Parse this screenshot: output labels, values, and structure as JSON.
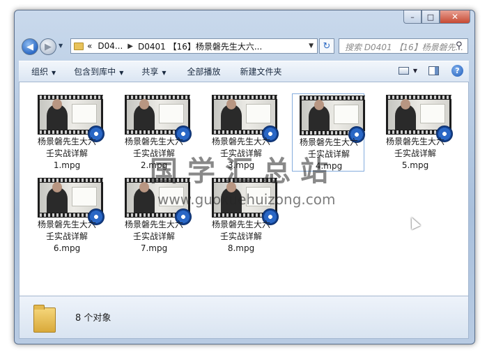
{
  "window": {
    "controls": {
      "minimize": "–",
      "maximize": "□",
      "close": "✕"
    }
  },
  "navigation": {
    "back_icon": "back-arrow-icon",
    "forward_icon": "forward-arrow-icon",
    "breadcrumb": {
      "overflow": "«",
      "parent": "D04...",
      "current": "D0401 【16】杨景磐先生大六..."
    },
    "search_placeholder": "搜索 D0401 【16】杨景磐先..."
  },
  "toolbar": {
    "organize": "组织",
    "include_in_library": "包含到库中",
    "share": "共享",
    "play_all": "全部播放",
    "new_folder": "新建文件夹"
  },
  "files": [
    {
      "line1": "杨景磐先生大六",
      "line2": "壬实战详解",
      "line3": "1.mpg"
    },
    {
      "line1": "杨景磐先生大六",
      "line2": "壬实战详解",
      "line3": "2.mpg"
    },
    {
      "line1": "杨景磐先生大六",
      "line2": "壬实战详解",
      "line3": "3.mpg"
    },
    {
      "line1": "杨景磐先生大六",
      "line2": "壬实战详解",
      "line3": "4.mpg"
    },
    {
      "line1": "杨景磐先生大六",
      "line2": "壬实战详解",
      "line3": "5.mpg"
    },
    {
      "line1": "杨景磐先生大六",
      "line2": "壬实战详解",
      "line3": "6.mpg"
    },
    {
      "line1": "杨景磐先生大六",
      "line2": "壬实战详解",
      "line3": "7.mpg"
    },
    {
      "line1": "杨景磐先生大六",
      "line2": "壬实战详解",
      "line3": "8.mpg"
    }
  ],
  "selected_index": 3,
  "watermark": {
    "chinese": "国学汇总站",
    "url": "www.guoxuehuizong.com"
  },
  "details": {
    "count": "8 个对象"
  },
  "colors": {
    "accent": "#2c6ac6",
    "frame": "#a9c0dc",
    "selection_border": "#84acdd"
  }
}
